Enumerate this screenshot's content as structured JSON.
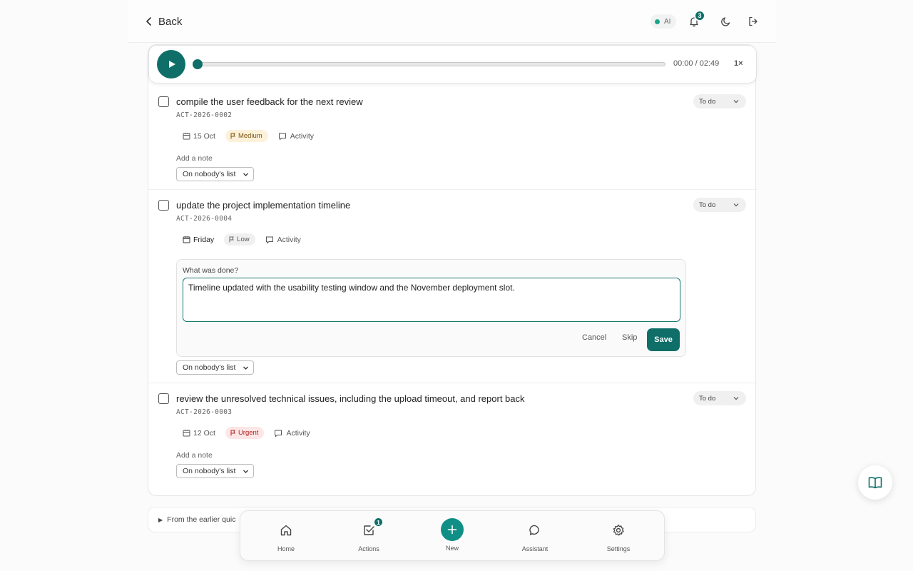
{
  "header": {
    "back_label": "Back",
    "ai_label": "AI",
    "notification_count": "3"
  },
  "audio": {
    "time": "00:00 / 02:49",
    "speed": "1×",
    "progress": 0
  },
  "tasks": [
    {
      "title": "compile the user feedback for the next review",
      "id": "ACT-2026-0002",
      "status": "To do",
      "date": "15 Oct",
      "priority": "Medium",
      "activity": "Activity",
      "add_note": "Add a note",
      "assignee": "On nobody's list"
    },
    {
      "title": "update the project implementation timeline",
      "id": "ACT-2026-0004",
      "status": "To do",
      "date": "Friday",
      "priority": "Low",
      "activity": "Activity",
      "assignee": "On nobody's list",
      "note_editor": {
        "label": "What was done?",
        "value": "Timeline updated with the usability testing window and the November deployment slot.",
        "cancel": "Cancel",
        "skip": "Skip",
        "save": "Save"
      }
    },
    {
      "title": "review the unresolved technical issues, including the upload timeout, and report back",
      "id": "ACT-2026-0003",
      "status": "To do",
      "date": "12 Oct",
      "priority": "Urgent",
      "activity": "Activity",
      "add_note": "Add a note",
      "assignee": "On nobody's list"
    }
  ],
  "collapsed_section": {
    "label": "From the earlier quic"
  },
  "bottom_nav": {
    "items": [
      {
        "label": "Home",
        "icon": "home-icon"
      },
      {
        "label": "Actions",
        "icon": "checkbox-icon",
        "badge": "1"
      },
      {
        "label": "New",
        "icon": "plus-icon"
      },
      {
        "label": "Assistant",
        "icon": "chat-icon"
      },
      {
        "label": "Settings",
        "icon": "gear-icon"
      }
    ]
  },
  "colors": {
    "accent": "#0f6f68",
    "medium_bg": "#fdf1da",
    "urgent_bg": "#fde6e6"
  }
}
